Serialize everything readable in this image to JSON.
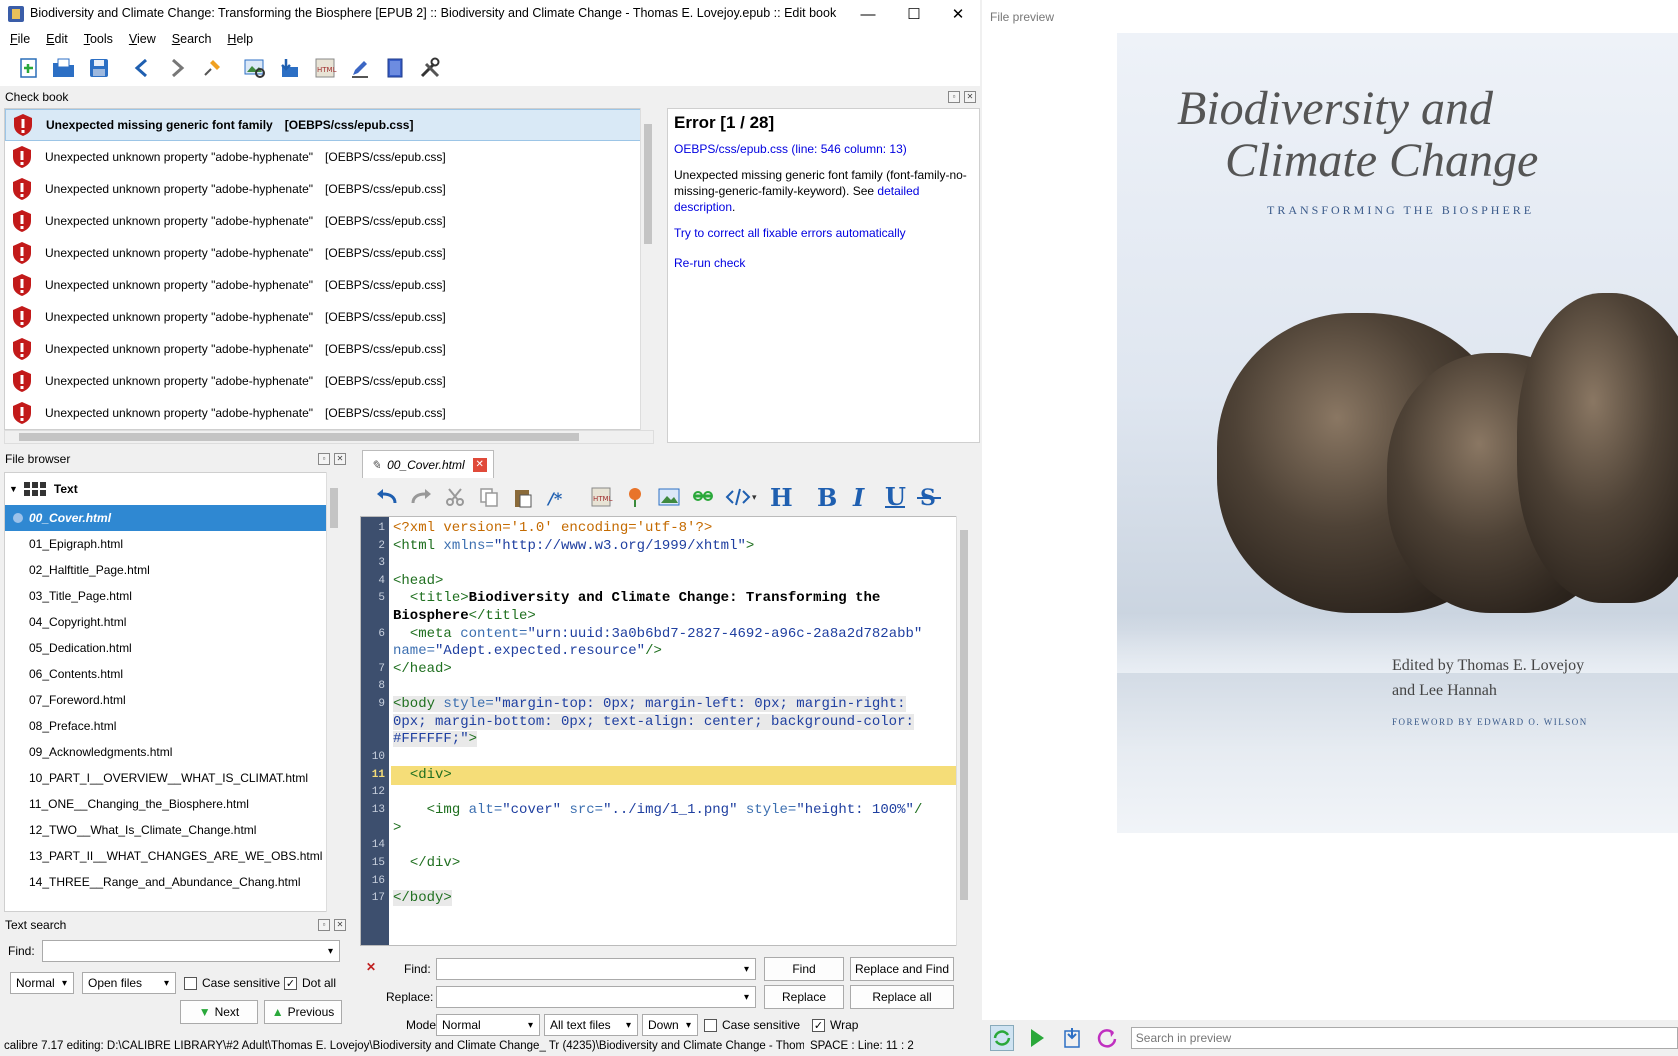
{
  "window": {
    "title": "Biodiversity and Climate Change: Transforming the Biosphere [EPUB 2] :: Biodiversity and Climate Change - Thomas E. Lovejoy.epub :: Edit book",
    "minimize": "—",
    "maximize": "☐",
    "close": "✕"
  },
  "menu": [
    "File",
    "Edit",
    "Tools",
    "View",
    "Search",
    "Help"
  ],
  "toolbar": {
    "icons": [
      "new-file-icon",
      "open-book-icon",
      "save-icon",
      "back-icon",
      "forward-icon",
      "pin-icon",
      "image-viewer-icon",
      "import-icon",
      "html-report-icon",
      "edit-icon",
      "book-icon",
      "tools-icon"
    ]
  },
  "check_book": {
    "title": "Check book",
    "errors": [
      {
        "message": "Unexpected missing generic font family",
        "file": "[OEBPS/css/epub.css]"
      },
      {
        "message": "Unexpected unknown property \"adobe-hyphenate\"",
        "file": "[OEBPS/css/epub.css]"
      },
      {
        "message": "Unexpected unknown property \"adobe-hyphenate\"",
        "file": "[OEBPS/css/epub.css]"
      },
      {
        "message": "Unexpected unknown property \"adobe-hyphenate\"",
        "file": "[OEBPS/css/epub.css]"
      },
      {
        "message": "Unexpected unknown property \"adobe-hyphenate\"",
        "file": "[OEBPS/css/epub.css]"
      },
      {
        "message": "Unexpected unknown property \"adobe-hyphenate\"",
        "file": "[OEBPS/css/epub.css]"
      },
      {
        "message": "Unexpected unknown property \"adobe-hyphenate\"",
        "file": "[OEBPS/css/epub.css]"
      },
      {
        "message": "Unexpected unknown property \"adobe-hyphenate\"",
        "file": "[OEBPS/css/epub.css]"
      },
      {
        "message": "Unexpected unknown property \"adobe-hyphenate\"",
        "file": "[OEBPS/css/epub.css]"
      },
      {
        "message": "Unexpected unknown property \"adobe-hyphenate\"",
        "file": "[OEBPS/css/epub.css]"
      }
    ],
    "detail": {
      "heading": "Error [1 / 28]",
      "location_link": "OEBPS/css/epub.css (line: 546 column: 13)",
      "description": "Unexpected missing generic font family (font-family-no-missing-generic-family-keyword). See ",
      "description_link": "detailed description",
      "description_end": ".",
      "fix_link": "Try to correct all fixable errors automatically",
      "rerun_link": "Re-run check"
    }
  },
  "file_browser": {
    "title": "File browser",
    "folder": "Text",
    "files": [
      "00_Cover.html",
      "01_Epigraph.html",
      "02_Halftitle_Page.html",
      "03_Title_Page.html",
      "04_Copyright.html",
      "05_Dedication.html",
      "06_Contents.html",
      "07_Foreword.html",
      "08_Preface.html",
      "09_Acknowledgments.html",
      "10_PART_I__OVERVIEW__WHAT_IS_CLIMAT.html",
      "11_ONE__Changing_the_Biosphere.html",
      "12_TWO__What_Is_Climate_Change.html",
      "13_PART_II__WHAT_CHANGES_ARE_WE_OBS.html",
      "14_THREE__Range_and_Abundance_Chang.html"
    ]
  },
  "text_search": {
    "title": "Text search",
    "find_label": "Find:",
    "find_value": "",
    "mode": "Normal",
    "scope": "Open files",
    "case_sensitive_label": "Case sensitive",
    "case_sensitive": false,
    "dot_all_label": "Dot all",
    "dot_all": true,
    "next": "Next",
    "previous": "Previous"
  },
  "editor": {
    "tab_label": "00_Cover.html",
    "current_line": 11,
    "lines": [
      {
        "n": "1"
      },
      {
        "n": "2"
      },
      {
        "n": "3"
      },
      {
        "n": "4"
      },
      {
        "n": "5"
      },
      {
        "n": ""
      },
      {
        "n": "6"
      },
      {
        "n": ""
      },
      {
        "n": "7"
      },
      {
        "n": "8"
      },
      {
        "n": "9"
      },
      {
        "n": ""
      },
      {
        "n": ""
      },
      {
        "n": "10"
      },
      {
        "n": "11"
      },
      {
        "n": "12"
      },
      {
        "n": "13"
      },
      {
        "n": ""
      },
      {
        "n": "14"
      },
      {
        "n": "15"
      },
      {
        "n": "16"
      },
      {
        "n": "17"
      }
    ]
  },
  "find_bar": {
    "find_label": "Find:",
    "replace_label": "Replace:",
    "mode_label": "Mode:",
    "find_value": "",
    "replace_value": "",
    "find_button": "Find",
    "replace_and_find": "Replace and Find",
    "replace_button": "Replace",
    "replace_all": "Replace all",
    "mode": "Normal",
    "scope": "All text files",
    "direction": "Down",
    "case_sensitive_label": "Case sensitive",
    "case_sensitive": false,
    "wrap_label": "Wrap",
    "wrap": true
  },
  "status": {
    "left": "calibre 7.17 editing: D:\\CALIBRE LIBRARY\\#2 Adult\\Thomas E. Lovejoy\\Biodiversity and Climate Change_ Tr (4235)\\Biodiversity and Climate Change - Thomas E. L",
    "right": "SPACE : Line: 11 : 2"
  },
  "preview": {
    "title": "File preview",
    "cover_title_line1": "Biodiversity and",
    "cover_title_line2": "Climate Change",
    "cover_subtitle": "TRANSFORMING THE BIOSPHERE",
    "editors_line1": "Edited by Thomas E. Lovejoy",
    "editors_line2": "and Lee Hannah",
    "foreword": "FOREWORD BY EDWARD O. WILSON",
    "search_placeholder": "Search in preview"
  }
}
